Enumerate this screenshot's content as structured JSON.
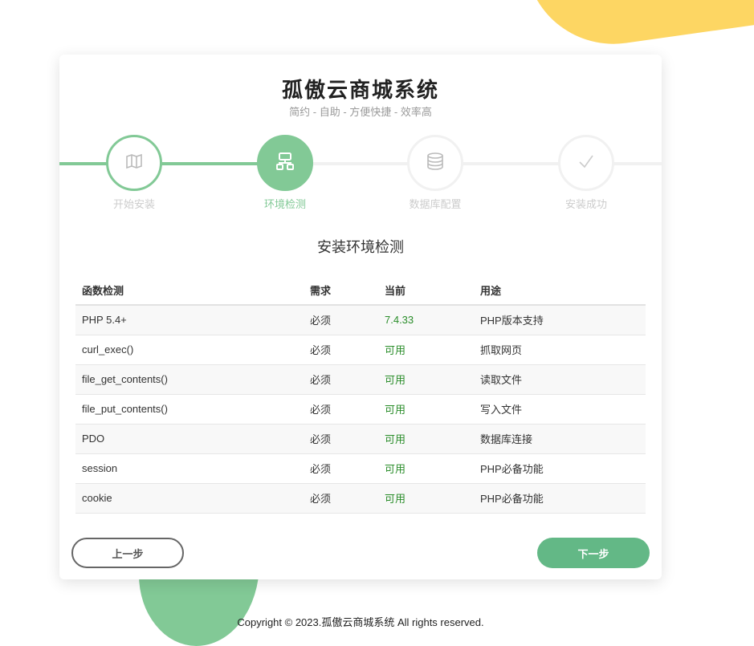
{
  "header": {
    "title": "孤傲云商城系统",
    "subtitle": "简约 - 自助 - 方便快捷 - 效率高"
  },
  "steps": [
    {
      "label": "开始安装",
      "icon": "map-icon",
      "state": "done"
    },
    {
      "label": "环境检测",
      "icon": "network-icon",
      "state": "active"
    },
    {
      "label": "数据库配置",
      "icon": "database-icon",
      "state": "pending"
    },
    {
      "label": "安装成功",
      "icon": "check-icon",
      "state": "pending"
    }
  ],
  "section_title": "安装环境检测",
  "table": {
    "headers": [
      "函数检测",
      "需求",
      "当前",
      "用途"
    ],
    "rows": [
      [
        "PHP 5.4+",
        "必须",
        "7.4.33",
        "PHP版本支持"
      ],
      [
        "curl_exec()",
        "必须",
        "可用",
        "抓取网页"
      ],
      [
        "file_get_contents()",
        "必须",
        "可用",
        "读取文件"
      ],
      [
        "file_put_contents()",
        "必须",
        "可用",
        "写入文件"
      ],
      [
        "PDO",
        "必须",
        "可用",
        "数据库连接"
      ],
      [
        "session",
        "必须",
        "可用",
        "PHP必备功能"
      ],
      [
        "cookie",
        "必须",
        "可用",
        "PHP必备功能"
      ]
    ]
  },
  "buttons": {
    "prev": "上一步",
    "next": "下一步"
  },
  "footer": "Copyright © 2023.孤傲云商城系统 All rights reserved.",
  "colors": {
    "accent": "#82c996",
    "button_green": "#63b886",
    "yellow_blob": "#fdd663",
    "ok_text": "#2a8d2a"
  }
}
